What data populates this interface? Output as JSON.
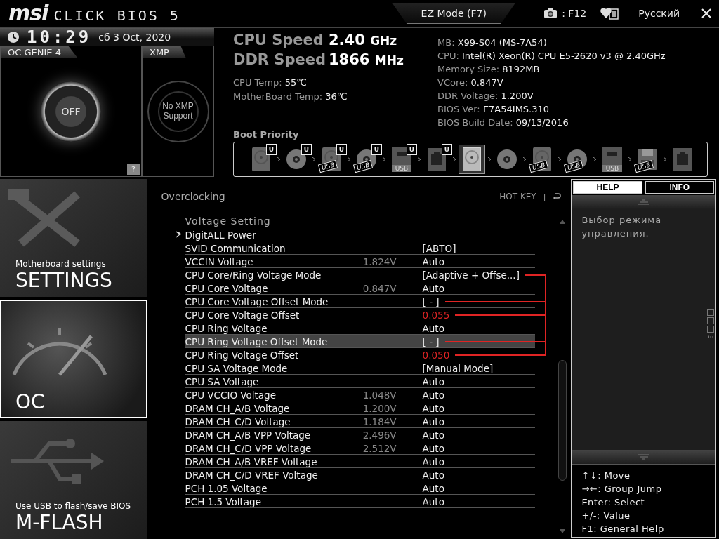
{
  "header": {
    "logo": "msi",
    "product": "CLICK BIOS 5",
    "mode_button": "EZ Mode (F7)",
    "screenshot_key": ": F12",
    "language": "Русский"
  },
  "clock": {
    "time": "10:29",
    "date": "сб  3 Oct, 2020"
  },
  "oc_genie": {
    "title": "OC GENIE 4",
    "state": "OFF",
    "on": false,
    "help": "?"
  },
  "xmp": {
    "title": "XMP",
    "status": "No XMP Support"
  },
  "speeds": [
    {
      "label": "CPU Speed",
      "value": "2.40",
      "unit": "GHz"
    },
    {
      "label": "DDR Speed",
      "value": "1866",
      "unit": "MHz"
    }
  ],
  "temps": [
    {
      "label": "CPU Temp:",
      "value": "55℃"
    },
    {
      "label": "MotherBoard Temp:",
      "value": "36℃"
    }
  ],
  "system_info": [
    {
      "label": "MB:",
      "value": "X99-S04 (MS-7A54)"
    },
    {
      "label": "CPU:",
      "value": "Intel(R) Xeon(R) CPU E5-2620 v3 @ 2.40GHz"
    },
    {
      "label": "Memory Size:",
      "value": "8192MB"
    },
    {
      "label": "VCore:",
      "value": "0.847V"
    },
    {
      "label": "DDR Voltage:",
      "value": "1.200V"
    },
    {
      "label": "BIOS Ver:",
      "value": "E7A54IMS.310"
    },
    {
      "label": "BIOS Build Date:",
      "value": "09/13/2016"
    }
  ],
  "boot_priority": {
    "title": "Boot Priority",
    "devices": [
      {
        "kind": "hdd",
        "badge": "U",
        "highlighted": false
      },
      {
        "kind": "optical",
        "badge": "U",
        "highlighted": false
      },
      {
        "kind": "hdd",
        "badge": "U",
        "tag": "USB",
        "highlighted": false
      },
      {
        "kind": "optical",
        "badge": "U",
        "tag": "USB",
        "highlighted": false
      },
      {
        "kind": "usb-key",
        "badge": "U",
        "label": "USB",
        "highlighted": false
      },
      {
        "kind": "network",
        "badge": "U",
        "highlighted": false
      },
      {
        "kind": "hdd",
        "highlighted": true
      },
      {
        "kind": "optical",
        "highlighted": false
      },
      {
        "kind": "hdd",
        "tag": "USB",
        "highlighted": false
      },
      {
        "kind": "optical",
        "tag": "USB",
        "highlighted": false
      },
      {
        "kind": "usb-key",
        "label": "USB",
        "highlighted": false
      },
      {
        "kind": "floppy",
        "tag": "USB",
        "highlighted": false
      },
      {
        "kind": "network",
        "highlighted": false
      }
    ]
  },
  "sidebar": {
    "items": [
      {
        "kind": "tools",
        "subtitle": "Motherboard settings",
        "title": "SETTINGS",
        "selected": false
      },
      {
        "kind": "gauge",
        "title": "OC",
        "selected": true
      },
      {
        "kind": "usb",
        "subtitle": "Use USB to flash/save BIOS",
        "title": "M-FLASH",
        "selected": false
      }
    ]
  },
  "main": {
    "breadcrumb": "Overclocking",
    "hotkey": "HOT KEY",
    "hotkey_separator": "|",
    "section": "Voltage Setting",
    "rows": [
      {
        "kind": "submenu",
        "name": "DigitALL Power",
        "selected": false
      },
      {
        "kind": "setting",
        "name": "SVID Communication",
        "value": "[ABTO]",
        "selected": false,
        "modified": false,
        "marked": false
      },
      {
        "kind": "setting",
        "name": "VCCIN Voltage",
        "reading": "1.824V",
        "value": "Auto",
        "selected": false,
        "modified": false,
        "marked": false
      },
      {
        "kind": "setting",
        "name": "CPU Core/Ring Voltage Mode",
        "value": "[Adaptive + Offse...]",
        "selected": false,
        "modified": false,
        "marked": true
      },
      {
        "kind": "setting",
        "name": "CPU Core Voltage",
        "reading": "0.847V",
        "value": "Auto",
        "selected": false,
        "modified": false,
        "marked": false
      },
      {
        "kind": "setting",
        "name": "CPU Core Voltage Offset Mode",
        "value": "[ - ]",
        "selected": false,
        "modified": false,
        "marked": true
      },
      {
        "kind": "setting",
        "name": "CPU Core Voltage Offset",
        "value": "0.055",
        "selected": false,
        "modified": true,
        "marked": true
      },
      {
        "kind": "setting",
        "name": "CPU Ring Voltage",
        "value": "Auto",
        "selected": false,
        "modified": false,
        "marked": false
      },
      {
        "kind": "setting",
        "name": "CPU Ring Voltage Offset Mode",
        "value": "[ - ]",
        "selected": true,
        "modified": false,
        "marked": true
      },
      {
        "kind": "setting",
        "name": "CPU Ring Voltage Offset",
        "value": "0.050",
        "selected": false,
        "modified": true,
        "marked": true
      },
      {
        "kind": "setting",
        "name": "CPU SA Voltage Mode",
        "value": "[Manual Mode]",
        "selected": false,
        "modified": false,
        "marked": false
      },
      {
        "kind": "setting",
        "name": "CPU SA Voltage",
        "value": "Auto",
        "selected": false,
        "modified": false,
        "marked": false
      },
      {
        "kind": "setting",
        "name": "CPU VCCIO Voltage",
        "reading": "1.048V",
        "value": "Auto",
        "selected": false,
        "modified": false,
        "marked": false
      },
      {
        "kind": "setting",
        "name": "DRAM CH_A/B Voltage",
        "reading": "1.200V",
        "value": "Auto",
        "selected": false,
        "modified": false,
        "marked": false
      },
      {
        "kind": "setting",
        "name": "DRAM CH_C/D Voltage",
        "reading": "1.184V",
        "value": "Auto",
        "selected": false,
        "modified": false,
        "marked": false
      },
      {
        "kind": "setting",
        "name": "DRAM CH_A/B VPP Voltage",
        "reading": "2.496V",
        "value": "Auto",
        "selected": false,
        "modified": false,
        "marked": false
      },
      {
        "kind": "setting",
        "name": "DRAM CH_C/D VPP Voltage",
        "reading": "2.512V",
        "value": "Auto",
        "selected": false,
        "modified": false,
        "marked": false
      },
      {
        "kind": "setting",
        "name": "DRAM CH_A/B VREF Voltage",
        "value": "Auto",
        "selected": false,
        "modified": false,
        "marked": false
      },
      {
        "kind": "setting",
        "name": "DRAM CH_C/D VREF Voltage",
        "value": "Auto",
        "selected": false,
        "modified": false,
        "marked": false
      },
      {
        "kind": "setting",
        "name": "PCH 1.05 Voltage",
        "value": "Auto",
        "selected": false,
        "modified": false,
        "marked": false
      },
      {
        "kind": "setting",
        "name": "PCH 1.5 Voltage",
        "value": "Auto",
        "selected": false,
        "modified": false,
        "marked": false
      }
    ]
  },
  "help": {
    "tabs": [
      {
        "label": "HELP",
        "selected": true
      },
      {
        "label": "INFO",
        "selected": false
      }
    ],
    "text": "Выбор режима управления.",
    "keys": [
      "↑↓: Move",
      "→←: Group Jump",
      "Enter: Select",
      "+/-: Value",
      "F1: General Help"
    ]
  }
}
